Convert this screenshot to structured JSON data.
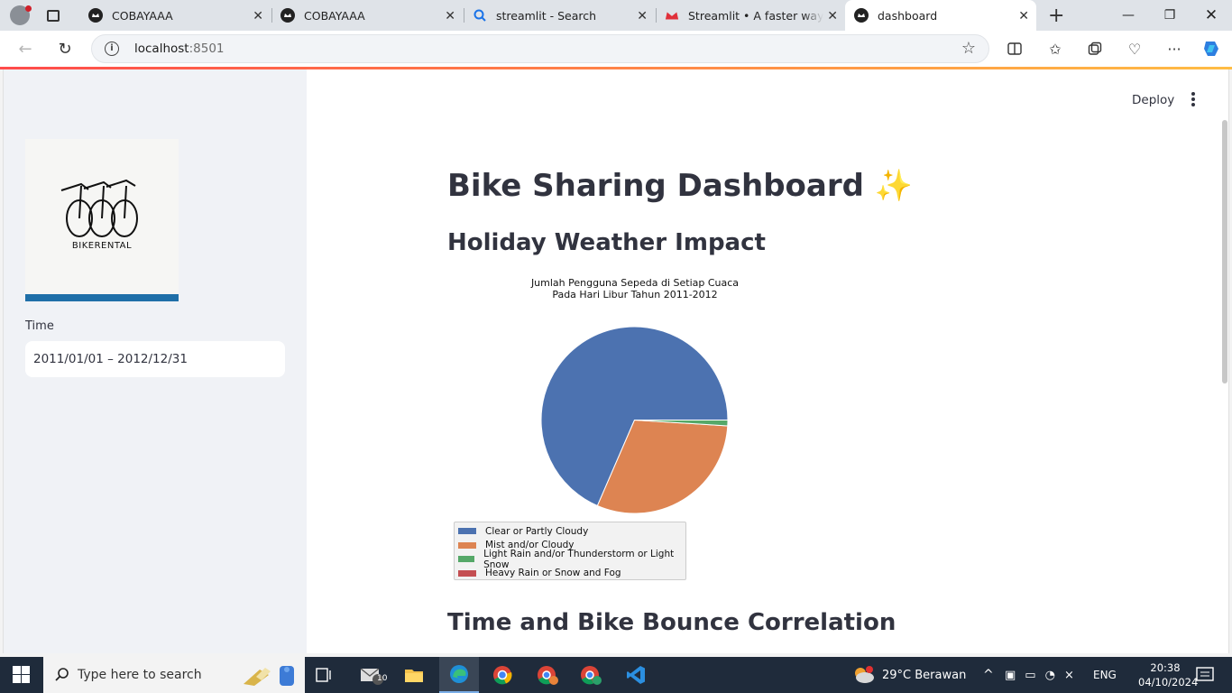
{
  "browser": {
    "tabs": [
      {
        "title": "COBAYAAA",
        "icon": "streamlit-icon"
      },
      {
        "title": "COBAYAAA",
        "icon": "streamlit-icon"
      },
      {
        "title": "streamlit - Search",
        "icon": "search-icon"
      },
      {
        "title": "Streamlit • A faster way to bu",
        "icon": "streamlit-crown-icon"
      },
      {
        "title": "dashboard",
        "icon": "streamlit-icon"
      }
    ],
    "url_host": "localhost",
    "url_port": ":8501"
  },
  "sidebar": {
    "logo_text": "BIKERENTAL",
    "time_label": "Time",
    "date_range": "2011/01/01 – 2012/12/31"
  },
  "header": {
    "deploy_label": "Deploy"
  },
  "main": {
    "title": "Bike Sharing Dashboard",
    "title_emoji": "✨",
    "section1": "Holiday Weather Impact",
    "section2": "Time and Bike Bounce Correlation"
  },
  "chart_data": {
    "type": "pie",
    "title_line1": "Jumlah Pengguna Sepeda di Setiap Cuaca",
    "title_line2": "Pada Hari Libur Tahun 2011-2012",
    "categories": [
      "Clear or Partly Cloudy",
      "Mist and/or Cloudy",
      "Light Rain and/or Thunderstorm or Light Snow",
      "Heavy Rain or Snow and Fog"
    ],
    "values": [
      68.5,
      30.5,
      1.0,
      0.0
    ],
    "colors": [
      "#4c72b0",
      "#dd8452",
      "#55a868",
      "#c44e52"
    ],
    "legend_position": "bottom-left"
  },
  "taskbar": {
    "search_placeholder": "Type here to search",
    "mail_badge": "10",
    "weather": "29°C  Berawan",
    "language": "ENG",
    "time": "20:38",
    "date": "04/10/2024"
  }
}
